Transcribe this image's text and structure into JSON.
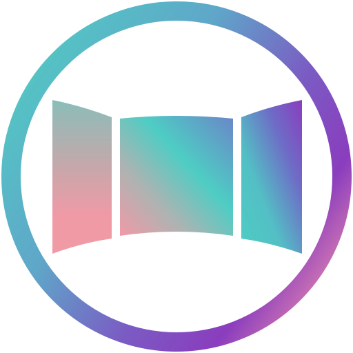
{
  "icon": {
    "name": "panorama-icon",
    "colors": {
      "teal": "#4ECDC4",
      "purple": "#8A3DBE",
      "pink": "#F09AA6",
      "blue_violet": "#6B74C6",
      "background": "#FFFFFF"
    }
  }
}
